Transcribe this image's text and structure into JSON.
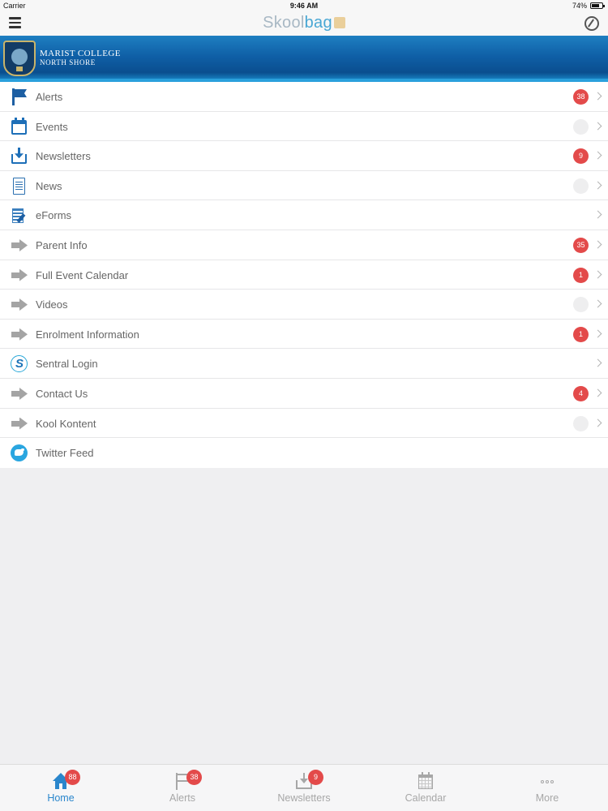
{
  "status_bar": {
    "carrier": "Carrier",
    "time": "9:46 AM",
    "battery": "74%",
    "battery_level": 0.74
  },
  "nav_bar": {
    "logo_part1": "Skool",
    "logo_part2": "bag"
  },
  "school": {
    "name_line1": "MARIST COLLEGE",
    "name_line2": "NORTH SHORE"
  },
  "menu": {
    "items": [
      {
        "label": "Alerts",
        "icon": "flag-icon",
        "badge": "38"
      },
      {
        "label": "Events",
        "icon": "calendar-icon",
        "badge": ""
      },
      {
        "label": "Newsletters",
        "icon": "inbox-download-icon",
        "badge": "9"
      },
      {
        "label": "News",
        "icon": "document-icon",
        "badge": ""
      },
      {
        "label": "eForms",
        "icon": "form-pen-icon"
      },
      {
        "label": "Parent Info",
        "icon": "arrow-right-icon",
        "badge": "35"
      },
      {
        "label": "Full Event Calendar",
        "icon": "arrow-right-icon",
        "badge": "1"
      },
      {
        "label": "Videos",
        "icon": "arrow-right-icon",
        "badge": ""
      },
      {
        "label": "Enrolment Information",
        "icon": "arrow-right-icon",
        "badge": "1"
      },
      {
        "label": "Sentral Login",
        "icon": "sentral-icon"
      },
      {
        "label": "Contact Us",
        "icon": "arrow-right-icon",
        "badge": "4"
      },
      {
        "label": "Kool Kontent",
        "icon": "arrow-right-icon",
        "badge": ""
      },
      {
        "label": "Twitter Feed",
        "icon": "twitter-icon"
      }
    ]
  },
  "tab_bar": {
    "tabs": [
      {
        "label": "Home",
        "icon": "home-icon",
        "badge": "88",
        "active": true
      },
      {
        "label": "Alerts",
        "icon": "flag-icon",
        "badge": "38"
      },
      {
        "label": "Newsletters",
        "icon": "inbox-download-icon",
        "badge": "9"
      },
      {
        "label": "Calendar",
        "icon": "calendar-icon"
      },
      {
        "label": "More",
        "icon": "more-dots-icon"
      }
    ]
  },
  "colors": {
    "accent": "#2a86cc",
    "badge": "#e34a4a",
    "banner": "#0f5fa6",
    "logo_light": "#a8b8c4",
    "logo_blue": "#49a7d4"
  }
}
